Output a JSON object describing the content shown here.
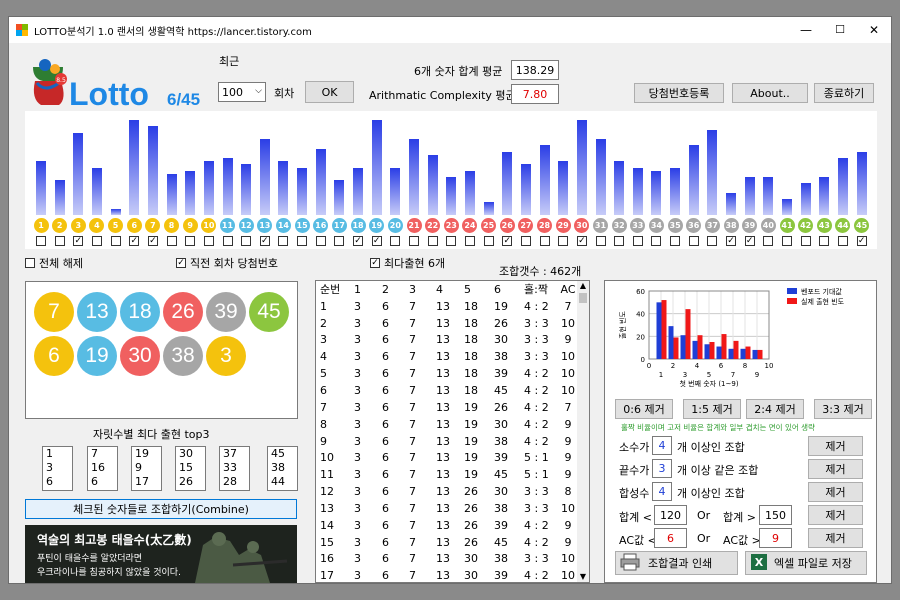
{
  "title": "LOTTO분석기 1.0  랜서의 생활역학 https://lancer.tistory.com",
  "window_controls": {
    "minimize": "—",
    "maximize": "☐",
    "close": "✕"
  },
  "logo": {
    "text_main": "Lotto",
    "text_sub": "6/45",
    "badge": "8.5"
  },
  "recent": {
    "label": "최근",
    "value": "100",
    "unit": "회차",
    "ok": "OK"
  },
  "sum_avg": {
    "label": "6개 숫자 합계 평균",
    "value": "138.29"
  },
  "ac_avg": {
    "label": "Arithmatic Complexity 평균",
    "value": "7.80"
  },
  "buttons": {
    "register": "당첨번호등록",
    "about": "About..",
    "exit": "종료하기"
  },
  "bars": {
    "numbers": [
      1,
      2,
      3,
      4,
      5,
      6,
      7,
      8,
      9,
      10,
      11,
      12,
      13,
      14,
      15,
      16,
      17,
      18,
      19,
      20,
      21,
      22,
      23,
      24,
      25,
      26,
      27,
      28,
      29,
      30,
      31,
      32,
      33,
      34,
      35,
      36,
      37,
      38,
      39,
      40,
      41,
      42,
      43,
      44,
      45
    ],
    "counts": [
      17,
      11,
      26,
      15,
      2,
      30,
      28,
      13,
      14,
      17,
      18,
      16,
      24,
      17,
      15,
      21,
      11,
      15,
      30,
      15,
      24,
      19,
      12,
      14,
      4,
      20,
      16,
      22,
      17,
      30,
      24,
      17,
      15,
      14,
      15,
      22,
      27,
      7,
      12,
      12,
      5,
      10,
      12,
      18,
      20
    ],
    "checked": [
      false,
      false,
      true,
      false,
      false,
      true,
      true,
      false,
      false,
      false,
      false,
      false,
      true,
      false,
      false,
      false,
      false,
      true,
      true,
      false,
      false,
      false,
      false,
      false,
      false,
      true,
      false,
      false,
      false,
      true,
      false,
      false,
      false,
      false,
      false,
      false,
      false,
      true,
      true,
      false,
      false,
      false,
      false,
      false,
      true
    ],
    "colors": {
      "yellow": "#f4c20d",
      "blue": "#58bce3",
      "red": "#f06060",
      "gray": "#a6a6a6",
      "green": "#8cc63f"
    }
  },
  "options": {
    "deselect_all": "전체 해제",
    "prev_win": "직전 회차 당첨번호",
    "most_freq": "최다출현 6개"
  },
  "combo_count": "조합갯수 : 462개",
  "selected_balls": [
    {
      "n": "7",
      "color": "#f4c20d"
    },
    {
      "n": "13",
      "color": "#58bce3"
    },
    {
      "n": "18",
      "color": "#58bce3"
    },
    {
      "n": "26",
      "color": "#f06060"
    },
    {
      "n": "39",
      "color": "#a6a6a6"
    },
    {
      "n": "45",
      "color": "#8cc63f"
    },
    {
      "n": "6",
      "color": "#f4c20d"
    },
    {
      "n": "19",
      "color": "#58bce3"
    },
    {
      "n": "30",
      "color": "#f06060"
    },
    {
      "n": "38",
      "color": "#a6a6a6"
    },
    {
      "n": "3",
      "color": "#f4c20d"
    }
  ],
  "top3": {
    "label": "자릿수별 최다 출현 top3",
    "columns": [
      [
        "1",
        "3",
        "6"
      ],
      [
        "7",
        "16",
        "6"
      ],
      [
        "19",
        "9",
        "17"
      ],
      [
        "30",
        "15",
        "26"
      ],
      [
        "37",
        "33",
        "28"
      ],
      [
        "45",
        "38",
        "44"
      ]
    ]
  },
  "combine_button": "체크된 숫자들로 조합하기(Combine)",
  "banner": {
    "title": "역술의 최고봉 태을수(太乙數)",
    "line1": "푸틴이 태을수를 알았더라면",
    "line2": "우크라이나를 침공하지 않았을 것이다."
  },
  "table": {
    "headers": [
      "순번",
      "1",
      "2",
      "3",
      "4",
      "5",
      "6",
      "홀:짝",
      "AC"
    ],
    "rows": [
      [
        "1",
        "3",
        "6",
        "7",
        "13",
        "18",
        "19",
        "4 : 2",
        "7"
      ],
      [
        "2",
        "3",
        "6",
        "7",
        "13",
        "18",
        "26",
        "3 : 3",
        "10"
      ],
      [
        "3",
        "3",
        "6",
        "7",
        "13",
        "18",
        "30",
        "3 : 3",
        "9"
      ],
      [
        "4",
        "3",
        "6",
        "7",
        "13",
        "18",
        "38",
        "3 : 3",
        "10"
      ],
      [
        "5",
        "3",
        "6",
        "7",
        "13",
        "18",
        "39",
        "4 : 2",
        "10"
      ],
      [
        "6",
        "3",
        "6",
        "7",
        "13",
        "18",
        "45",
        "4 : 2",
        "10"
      ],
      [
        "7",
        "3",
        "6",
        "7",
        "13",
        "19",
        "26",
        "4 : 2",
        "7"
      ],
      [
        "8",
        "3",
        "6",
        "7",
        "13",
        "19",
        "30",
        "4 : 2",
        "9"
      ],
      [
        "9",
        "3",
        "6",
        "7",
        "13",
        "19",
        "38",
        "4 : 2",
        "9"
      ],
      [
        "10",
        "3",
        "6",
        "7",
        "13",
        "19",
        "39",
        "5 : 1",
        "9"
      ],
      [
        "11",
        "3",
        "6",
        "7",
        "13",
        "19",
        "45",
        "5 : 1",
        "9"
      ],
      [
        "12",
        "3",
        "6",
        "7",
        "13",
        "26",
        "30",
        "3 : 3",
        "8"
      ],
      [
        "13",
        "3",
        "6",
        "7",
        "13",
        "26",
        "38",
        "3 : 3",
        "10"
      ],
      [
        "14",
        "3",
        "6",
        "7",
        "13",
        "26",
        "39",
        "4 : 2",
        "9"
      ],
      [
        "15",
        "3",
        "6",
        "7",
        "13",
        "26",
        "45",
        "4 : 2",
        "9"
      ],
      [
        "16",
        "3",
        "6",
        "7",
        "13",
        "30",
        "38",
        "3 : 3",
        "10"
      ],
      [
        "17",
        "3",
        "6",
        "7",
        "13",
        "30",
        "39",
        "4 : 2",
        "10"
      ]
    ]
  },
  "chart_data": {
    "type": "bar",
    "xlabel": "첫 번째 숫자 (1~9)",
    "ylabel": "출현 빈도",
    "ylim": [
      0,
      60
    ],
    "yticks": [
      "0",
      "20",
      "40",
      "60"
    ],
    "xticks_top": [
      "0",
      "2",
      "4",
      "6",
      "8",
      "10"
    ],
    "xticks_bottom": [
      "1",
      "3",
      "5",
      "7",
      "9"
    ],
    "categories": [
      "1",
      "2",
      "3",
      "4",
      "5",
      "6",
      "7",
      "8",
      "9"
    ],
    "series": [
      {
        "name": "벤포드 기대값",
        "color": "#1f3fd6",
        "values": [
          50,
          29,
          21,
          16,
          13,
          11,
          9,
          9,
          8
        ]
      },
      {
        "name": "실제 출현 빈도",
        "color": "#f01818",
        "values": [
          52,
          19,
          44,
          21,
          15,
          22,
          16,
          11,
          8
        ]
      }
    ],
    "legend": "top-right"
  },
  "filters": {
    "buttons": [
      "0:6 제거",
      "1:5 제거",
      "2:4 제거",
      "3:3 제거"
    ],
    "note": "홀짝 비율이며 고저 비율은 합계와 일부 겹치는 면이 있어 생략",
    "prime": {
      "prefix": "소수가",
      "value": "4",
      "suffix": "개 이상인 조합"
    },
    "ending": {
      "prefix": "끝수가",
      "value": "3",
      "suffix": "개 이상 같은 조합"
    },
    "composite": {
      "prefix": "합성수",
      "value": "4",
      "suffix": "개 이상인 조합"
    },
    "sum": {
      "label1": "합계 <",
      "value1": "120",
      "or": "Or",
      "label2": "합계 >",
      "value2": "150"
    },
    "ac": {
      "label1": "AC값 <",
      "value1": "6",
      "or": "Or",
      "label2": "AC값 >",
      "value2": "9"
    },
    "remove": "제거",
    "print": "조합결과 인쇄",
    "excel": "엑셀 파일로 저장"
  }
}
